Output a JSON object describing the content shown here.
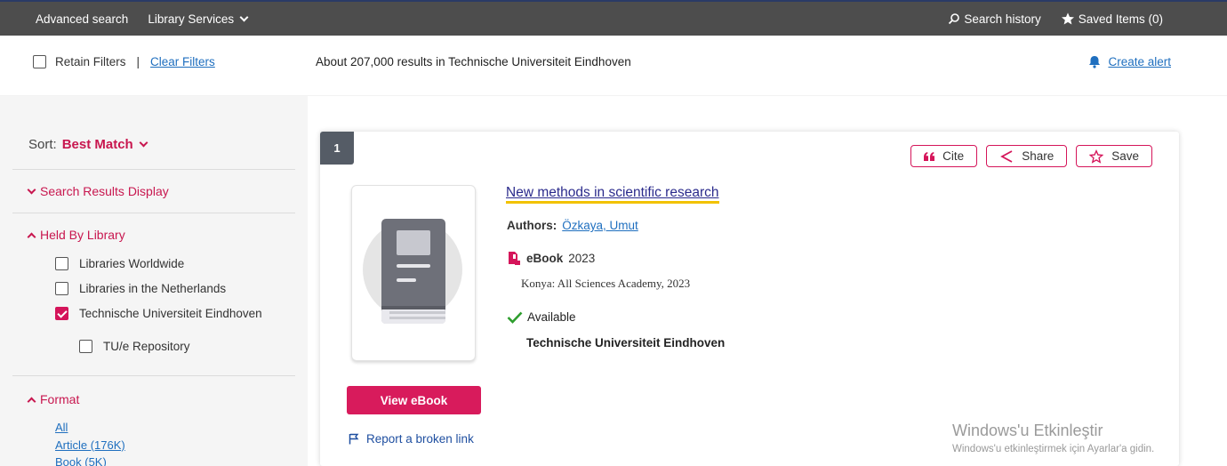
{
  "topnav": {
    "advanced_search": "Advanced search",
    "library_services": "Library Services",
    "search_history": "Search history",
    "saved_items": "Saved Items (0)"
  },
  "filters": {
    "retain_filters": "Retain Filters",
    "separator": "|",
    "clear_filters": "Clear Filters",
    "results_summary": "About 207,000 results in Technische Universiteit Eindhoven",
    "create_alert": "Create alert"
  },
  "sidebar": {
    "sort_label": "Sort:",
    "sort_value": "Best Match",
    "search_results_display": "Search Results Display",
    "held_by_library": "Held By Library",
    "library_options": [
      {
        "label": "Libraries Worldwide",
        "checked": false
      },
      {
        "label": "Libraries in the Netherlands",
        "checked": false
      },
      {
        "label": "Technische Universiteit Eindhoven",
        "checked": true
      },
      {
        "label": "TU/e Repository",
        "checked": false
      }
    ],
    "format": "Format",
    "format_options": [
      "All",
      "Article (176K)",
      "Book (5K)"
    ]
  },
  "result": {
    "index": "1",
    "actions": {
      "cite": "Cite",
      "share": "Share",
      "save": "Save"
    },
    "title": "New methods in scientific research",
    "authors_label": "Authors:",
    "author": "Özkaya, Umut",
    "format": "eBook",
    "year": "2023",
    "publisher": "Konya: All Sciences Academy, 2023",
    "availability": "Available",
    "held_by": "Technische Universiteit Eindhoven",
    "view_button": "View eBook",
    "report_link": "Report a broken link"
  },
  "watermark": {
    "line1": "Windows'u Etkinleştir",
    "line2": "Windows'u etkinleştirmek için Ayarlar'a gidin."
  },
  "colors": {
    "accent": "#d81b5c",
    "topbar": "#4d4d4d",
    "link": "#1f6fbf",
    "available": "#2e9e2e"
  }
}
